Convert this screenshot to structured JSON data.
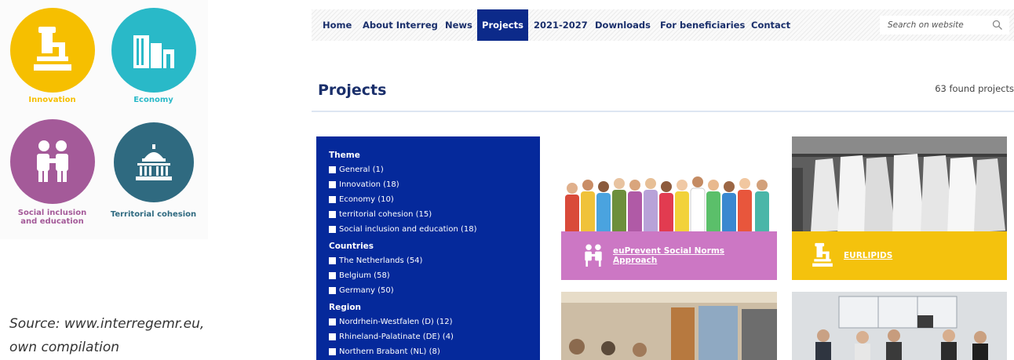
{
  "themes": [
    {
      "label": "Innovation",
      "color": "#f6bf00",
      "icon": "microscope-icon"
    },
    {
      "label": "Economy",
      "color": "#29b9c8",
      "icon": "buildings-icon"
    },
    {
      "label": "Social inclusion and education",
      "label_line1": "Social inclusion",
      "label_line2": "and education",
      "color": "#a45a99",
      "icon": "handshake-people-icon"
    },
    {
      "label": "Territorial cohesion",
      "color": "#2f6a80",
      "icon": "capitol-building-icon"
    }
  ],
  "source_note": {
    "line1": "Source: www.interregemr.eu,",
    "line2": "own compilation"
  },
  "nav": {
    "items": [
      "Home",
      "About Interreg",
      "News",
      "Projects",
      "2021-2027",
      "Downloads",
      "For beneficiaries",
      "Contact"
    ],
    "active": "Projects",
    "search_placeholder": "Search on website",
    "active_color": "#0c2a8a"
  },
  "page": {
    "title": "Projects",
    "found_count": "63 found projects"
  },
  "filters": {
    "theme": {
      "heading": "Theme",
      "items": [
        "General (1)",
        "Innovation (18)",
        "Economy (10)",
        "territorial cohesion (15)",
        "Social inclusion and education (18)"
      ]
    },
    "countries": {
      "heading": "Countries",
      "items": [
        "The Netherlands (54)",
        "Belgium (58)",
        "Germany (50)"
      ]
    },
    "region": {
      "heading": "Region",
      "items": [
        "Nordrhein-Westfalen (D) (12)",
        "Rhineland-Palatinate (DE) (4)",
        "Northern Brabant (NL) (8)"
      ]
    },
    "panel_color": "#05299b"
  },
  "projects": [
    {
      "title_line1": "euPrevent Social Norms",
      "title_line2": "Approach",
      "band_color": "#cc77c4",
      "icon": "handshake-people-icon"
    },
    {
      "title_line1": "EURLIPIDS",
      "title_line2": "",
      "band_color": "#f4c20d",
      "icon": "microscope-icon"
    }
  ]
}
